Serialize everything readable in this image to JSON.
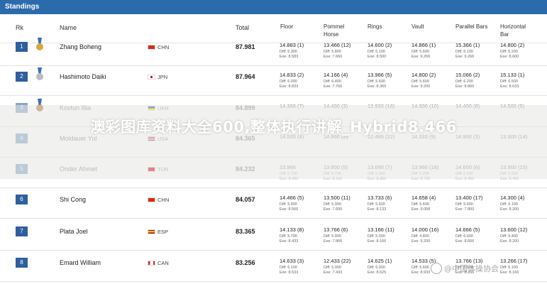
{
  "panel_title": "Standings",
  "headers": {
    "rk": "Rk",
    "name": "Name",
    "total": "Total",
    "events": [
      "Floor",
      "Pommel\nHorse",
      "Rings",
      "Vault",
      "Parallel Bars",
      "Horizontal\nBar"
    ]
  },
  "rows": [
    {
      "rk": "1",
      "medal": "gold",
      "name": "Zhang Boheng",
      "nat": "CHN",
      "total": "87.981",
      "cells": [
        [
          "14.883 (1)",
          "Diff: 6.300",
          "Exe: 8.583"
        ],
        [
          "13.466 (12)",
          "Diff: 5.800",
          "Exe: 7.666"
        ],
        [
          "14.600 (2)",
          "Diff: 6.100",
          "Exe: 8.500"
        ],
        [
          "14.866 (1)",
          "Diff: 5.600",
          "Exe: 9.266"
        ],
        [
          "15.366 (1)",
          "Diff: 6.100",
          "Exe: 9.266"
        ],
        [
          "14.800 (2)",
          "Diff: 6.200",
          "Exe: 8.600"
        ]
      ]
    },
    {
      "rk": "2",
      "medal": "silver",
      "name": "Hashimoto Daiki",
      "nat": "JPN",
      "total": "87.964",
      "cells": [
        [
          "14.833 (2)",
          "Diff: 6.000",
          "Exe: 8.833"
        ],
        [
          "14.166 (4)",
          "Diff: 6.400",
          "Exe: 7.766"
        ],
        [
          "13.966 (5)",
          "Diff: 5.600",
          "Exe: 8.366"
        ],
        [
          "14.800 (2)",
          "Diff: 5.600",
          "Exe: 9.200"
        ],
        [
          "15.066 (2)",
          "Diff: 6.200",
          "Exe: 8.866"
        ],
        [
          "15.133 (1)",
          "Diff: 6.500",
          "Exe: 8.633"
        ]
      ]
    },
    {
      "rk": "3",
      "medal": "bronze",
      "name": "Kovtun Illia",
      "nat": "UKR",
      "total": "84.899",
      "faded": true,
      "cells": [
        [
          "14.366 (7)",
          "",
          ""
        ],
        [
          "14.400 (3)",
          "",
          ""
        ],
        [
          "12.933 (16)",
          "",
          ""
        ],
        [
          "14.300 (10)",
          "",
          ""
        ],
        [
          "14.400 (8)",
          "",
          ""
        ],
        [
          "14.500 (5)",
          "",
          ""
        ]
      ]
    },
    {
      "rk": "4",
      "medal": "",
      "name": "Moldauer Yul",
      "nat": "USA",
      "total": "84.365",
      "faded": true,
      "cells": [
        [
          "14.500 (4)",
          "",
          ""
        ],
        [
          "14.866 (2)",
          "",
          ""
        ],
        [
          "12.466 (22)",
          "",
          ""
        ],
        [
          "14.333 (9)",
          "",
          ""
        ],
        [
          "14.900 (3)",
          "",
          ""
        ],
        [
          "13.300 (14)",
          "",
          ""
        ]
      ]
    },
    {
      "rk": "5",
      "medal": "",
      "name": "Onder Ahmet",
      "nat": "TUR",
      "total": "84.232",
      "faded": true,
      "cells": [
        [
          "13.966",
          "Diff: 5.700",
          "Exe: 8.400"
        ],
        [
          "13.800 (5)",
          "Diff: 5.700",
          "Exe: 8.100"
        ],
        [
          "13.666 (7)",
          "Diff: 5.300",
          "Exe: 8.366"
        ],
        [
          "13.966 (18)",
          "Diff: 5.200",
          "Exe: 8.766"
        ],
        [
          "14.600 (6)",
          "Diff: 6.200",
          "Exe: 8.400"
        ],
        [
          "13.900 (15)",
          "Diff: 5.500",
          "Exe: 8.400"
        ]
      ]
    },
    {
      "rk": "6",
      "medal": "",
      "name": "Shi Cong",
      "nat": "CHN",
      "total": "84.057",
      "cells": [
        [
          "14.466 (5)",
          "Diff: 5.900",
          "Exe: 8.566"
        ],
        [
          "13.500 (11)",
          "Diff: 5.900",
          "Exe: 7.600"
        ],
        [
          "13.733 (6)",
          "Diff: 5.600",
          "Exe: 8.133"
        ],
        [
          "14.658 (4)",
          "Diff: 5.600",
          "Exe: 9.058"
        ],
        [
          "13.400 (17)",
          "Diff: 5.600",
          "Exe: 7.800"
        ],
        [
          "14.300 (4)",
          "Diff: 6.100",
          "Exe: 8.200"
        ]
      ]
    },
    {
      "rk": "7",
      "medal": "",
      "name": "Plata Joel",
      "nat": "ESP",
      "total": "83.365",
      "cells": [
        [
          "14.133 (8)",
          "Diff: 5.700",
          "Exe: 8.433"
        ],
        [
          "13.766 (6)",
          "Diff: 5.900",
          "Exe: 7.866"
        ],
        [
          "13.166 (11)",
          "Diff: 5.000",
          "Exe: 8.166"
        ],
        [
          "14.000 (16)",
          "Diff: 4.800",
          "Exe: 9.200"
        ],
        [
          "14.666 (5)",
          "Diff: 6.000",
          "Exe: 8.666"
        ],
        [
          "13.600 (12)",
          "Diff: 5.400",
          "Exe: 8.200"
        ]
      ]
    },
    {
      "rk": "8",
      "medal": "",
      "name": "Emard William",
      "nat": "CAN",
      "total": "83.256",
      "cells": [
        [
          "14.633 (3)",
          "Diff: 6.100",
          "Exe: 8.533"
        ],
        [
          "12.433 (22)",
          "Diff: 5.000",
          "Exe: 7.433"
        ],
        [
          "14.625 (1)",
          "Diff: 6.000",
          "Exe: 8.625"
        ],
        [
          "14.533 (5)",
          "Diff: 5.600",
          "Exe: 8.933"
        ],
        [
          "13.766 (13)",
          "Diff: 5.500",
          "Exe: 8.266"
        ],
        [
          "13.266 (17)",
          "Diff: 5.100",
          "Exe: 8.166"
        ]
      ]
    }
  ],
  "overlay_text": "澳彩图库资料大全600,整体执行讲解_Hybrid8.466",
  "watermark": "@中国体操协会",
  "colors": {
    "header_bar": "#2c6bab",
    "rank_badge": "#2e5f9e",
    "gold": "#d6a93a",
    "silver": "#b9bcc2",
    "bronze": "#b07a45"
  }
}
